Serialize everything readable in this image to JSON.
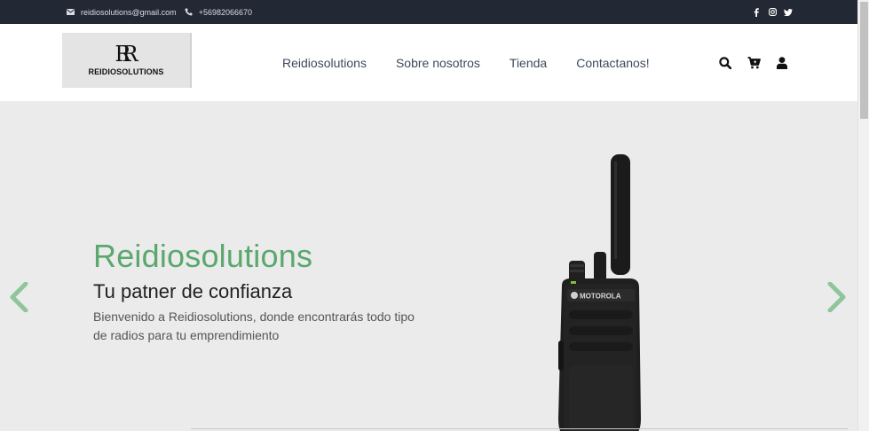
{
  "topbar": {
    "email": "reidiosolutions@gmail.com",
    "phone": "+56982066670",
    "social": [
      {
        "name": "facebook-icon"
      },
      {
        "name": "instagram-icon"
      },
      {
        "name": "twitter-icon"
      }
    ]
  },
  "header": {
    "logo_mark": "RR",
    "logo_text": "REIDIOSOLUTIONS",
    "nav": [
      "Reidiosolutions",
      "Sobre nosotros",
      "Tienda",
      "Contactanos!"
    ],
    "icons": [
      "search-icon",
      "cart-icon",
      "user-icon"
    ]
  },
  "hero": {
    "title": "Reidiosolutions",
    "subtitle": "Tu patner de confianza",
    "description": "Bienvenido a Reidiosolutions, donde encontrarás todo tipo de radios para tu emprendimiento",
    "product_brand": "MOTOROLA"
  },
  "colors": {
    "topbar_bg": "#222834",
    "accent_green": "#5aa86d",
    "hero_bg": "#ebebeb"
  }
}
